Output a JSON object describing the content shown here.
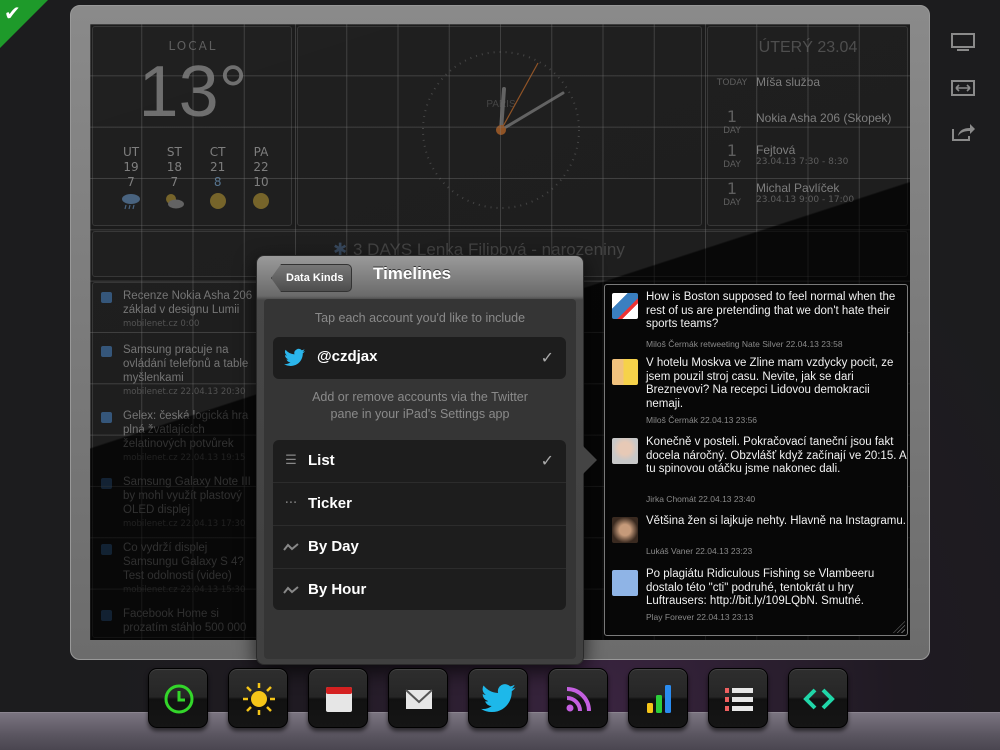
{
  "weather": {
    "label": "LOCAL",
    "temperature": "13°",
    "forecast": [
      {
        "day": "UT",
        "high": "19",
        "low": "7",
        "icon": "rain-cloud-icon"
      },
      {
        "day": "ST",
        "high": "18",
        "low": "7",
        "icon": "partly-cloudy-icon"
      },
      {
        "day": "CT",
        "high": "21",
        "low": "8",
        "icon": "sun-icon"
      },
      {
        "day": "PA",
        "high": "22",
        "low": "10",
        "icon": "sun-icon"
      }
    ]
  },
  "clock": {
    "label": "PARIS"
  },
  "agenda": {
    "title": "ÚTERÝ 23.04",
    "items": [
      {
        "left_label": "TODAY",
        "left_num": "",
        "name": "Míša služba",
        "time": ""
      },
      {
        "left_label": "DAY",
        "left_num": "1",
        "name": "Nokia Asha 206 (Skopek)",
        "time": ""
      },
      {
        "left_label": "DAY",
        "left_num": "1",
        "name": "Fejtová",
        "time": "23.04.13 7:30 - 8:30"
      },
      {
        "left_label": "DAY",
        "left_num": "1",
        "name": "Michal Pavlíček",
        "time": "23.04.13 9:00 - 17:00"
      }
    ]
  },
  "banner": {
    "text": "3 DAYS  Lenka Filipová - narozeniny"
  },
  "news": [
    {
      "title": [
        "Recenze Nokia Asha 206",
        "základ v designu Lumii"
      ],
      "source": "mobilenet.cz 0:00"
    },
    {
      "title": [
        "Samsung pracuje na",
        "ovládání telefonů a table",
        "myšlenkami"
      ],
      "source": "mobilenet.cz 22.04.13 20:30"
    },
    {
      "title": [
        "Gelex: česká logická hra",
        "plná žvatlajících",
        "želatinových potvůrek"
      ],
      "source": "mobilenet.cz 22.04.13 19:15"
    },
    {
      "title": [
        "Samsung Galaxy Note III",
        "by mohl využít plastový",
        "OLED displej"
      ],
      "source": "mobilenet.cz 22.04.13 17:30"
    },
    {
      "title": [
        "Co vydrží displej",
        "Samsungu Galaxy S 4?",
        "Test odolnosti (video)"
      ],
      "source": "mobilenet.cz 22.04.13 15:30"
    },
    {
      "title": [
        "Facebook Home si",
        "prozatím stáhlo 500 000"
      ],
      "source": ""
    }
  ],
  "tweets": [
    {
      "text": "How is Boston supposed to feel normal when the rest of us are pretending that we don't hate their sports teams?",
      "meta": "Miloš Čermák retweeting Nate Silver 22.04.13 23:58"
    },
    {
      "text": "V hotelu Moskva ve Zline mam vzdycky pocit, ze jsem pouzil stroj casu. Nevite, jak se dari Breznevovi? Na recepci Lidovou demokracii nemaji.",
      "meta": "Miloš Čermák 22.04.13 23:56"
    },
    {
      "text": "Konečně v posteli. Pokračovací taneční jsou fakt docela náročný. Obzvlášť když začínají ve 20:15. A tu spinovou otáčku jsme nakonec dali.",
      "meta": "Jirka Chomát 22.04.13 23:40"
    },
    {
      "text": "Většina žen si lajkuje nehty. Hlavně na Instagramu.",
      "meta": "Lukáš Vaner 22.04.13 23:23"
    },
    {
      "text": "Po plagiátu Ridiculous Fishing se Vlambeeru dostalo této \"cti\" podruhé, tentokrát u hry Luftrausers: http://bit.ly/109LQbN. Smutné.",
      "meta": "Play Forever 22.04.13 23:13"
    }
  ],
  "popover": {
    "back_label": "Data Kinds",
    "title": "Timelines",
    "account_hint": "Tap each account you'd like to include",
    "account": {
      "name": "@czdjax",
      "selected": true
    },
    "settings_hint_1": "Add or remove accounts via the Twitter",
    "settings_hint_2": "pane in your iPad's Settings app",
    "kinds": [
      {
        "label": "List",
        "icon": "list-icon",
        "selected": true
      },
      {
        "label": "Ticker",
        "icon": "ellipsis-icon",
        "selected": false
      },
      {
        "label": "By Day",
        "icon": "line-chart-icon",
        "selected": false
      },
      {
        "label": "By Hour",
        "icon": "line-chart-icon",
        "selected": false
      }
    ],
    "check_glyph": "✓"
  },
  "side_tools": [
    "display-icon",
    "resize-icon",
    "share-icon"
  ],
  "dock": [
    {
      "name": "clock",
      "color": "#33d62a"
    },
    {
      "name": "weather",
      "color": "#f5c518"
    },
    {
      "name": "calendar",
      "color": "#d42020"
    },
    {
      "name": "mail",
      "color": "#e6e6e6"
    },
    {
      "name": "twitter",
      "color": "#1db8ea"
    },
    {
      "name": "rss",
      "color": "#c45fe0"
    },
    {
      "name": "stats",
      "color": "#2a8cf0"
    },
    {
      "name": "list",
      "color": "#f06060"
    },
    {
      "name": "code",
      "color": "#20d6a8"
    }
  ]
}
